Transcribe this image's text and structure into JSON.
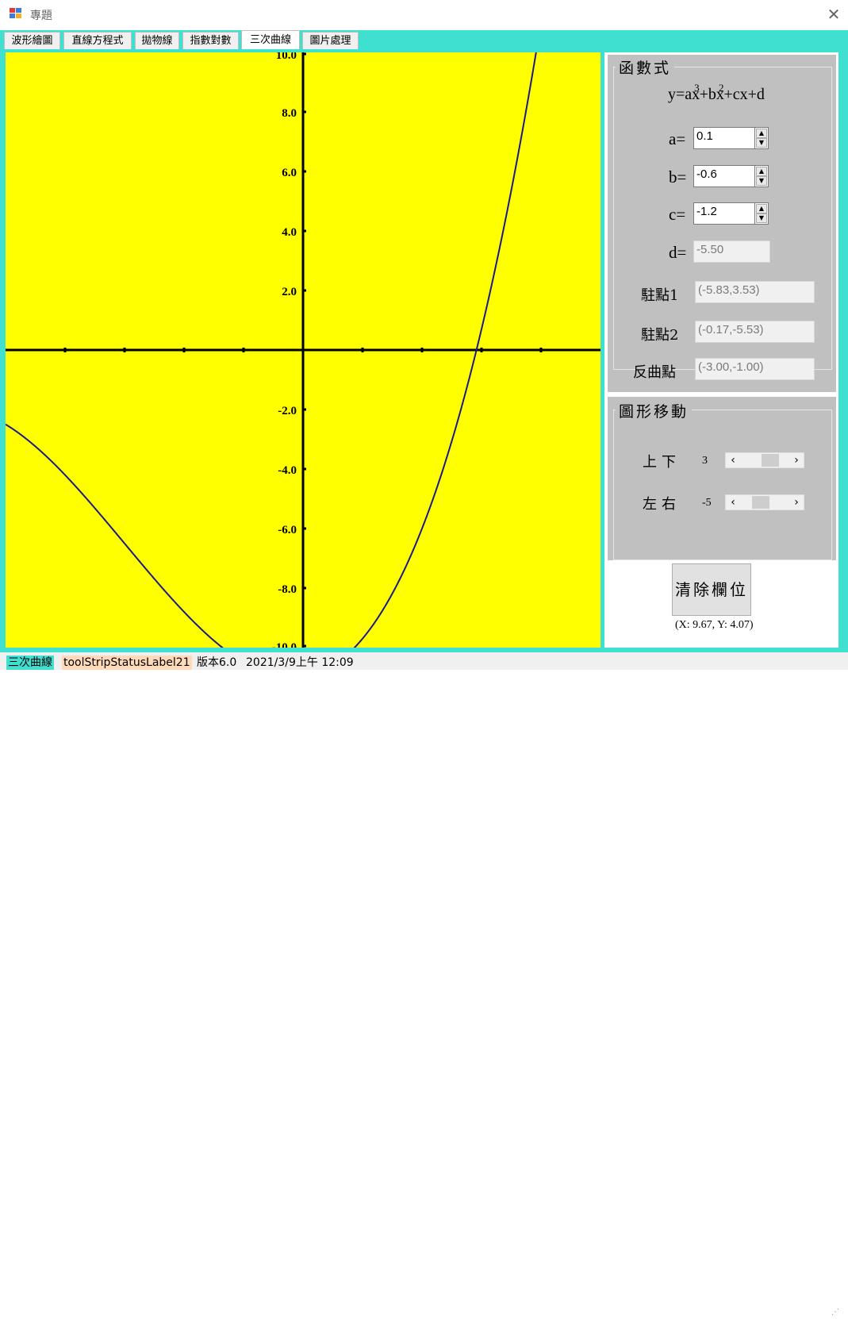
{
  "window": {
    "title": "專題",
    "close": "✕"
  },
  "tabs": [
    {
      "label": "波形繪圖",
      "active": false
    },
    {
      "label": "直線方程式",
      "active": false
    },
    {
      "label": "拋物線",
      "active": false
    },
    {
      "label": "指數對數",
      "active": false
    },
    {
      "label": "三次曲線",
      "active": true
    },
    {
      "label": "圖片處理",
      "active": false
    }
  ],
  "chart_data": {
    "type": "line",
    "x_range": [
      -5,
      5
    ],
    "y_range": [
      -10,
      10
    ],
    "y_ticks": [
      "10.0",
      "8.0",
      "6.0",
      "4.0",
      "2.0",
      "-2.0",
      "-4.0",
      "-6.0",
      "-8.0",
      "-10.0"
    ],
    "x_ticks": [
      -4,
      -3,
      -2,
      -1,
      1,
      2,
      3,
      4
    ],
    "curve": {
      "formula": "a(x-h)^3 + b(x-h)^2 + c(x-h) + d + k",
      "a": 0.1,
      "b": -0.6,
      "c": -1.2,
      "d": -5.5,
      "h": -5,
      "k": 3
    },
    "colors": {
      "background": "#ffff00",
      "axis": "#000000",
      "curve": "#1a1a8c"
    }
  },
  "formula_group": {
    "title": "函數式",
    "equation": {
      "pre": "y=ax",
      "exp1": "3",
      "mid": "+bx",
      "exp2": "2",
      "post": "+cx+d"
    },
    "a": {
      "label": "a=",
      "value": "0.1"
    },
    "b": {
      "label": "b=",
      "value": "-0.6"
    },
    "c": {
      "label": "c=",
      "value": "-1.2"
    },
    "d": {
      "label": "d=",
      "value": "-5.50"
    },
    "stationary1": {
      "label": "駐點1",
      "value": "(-5.83,3.53)"
    },
    "stationary2": {
      "label": "駐點2",
      "value": "(-0.17,-5.53)"
    },
    "inflection": {
      "label": "反曲點",
      "value": "(-3.00,-1.00)"
    }
  },
  "move_group": {
    "title": "圖形移動",
    "vertical": {
      "label": "上下",
      "value": "3",
      "position": 0.65
    },
    "horizontal": {
      "label": "左右",
      "value": "-5",
      "position": 0.35
    }
  },
  "clear_button": "清除欄位",
  "coordinate_readout": "(X: 9.67, Y: 4.07)",
  "statusbar": {
    "item1": "三次曲線",
    "item2": "toolStripStatusLabel21",
    "version": "版本6.0",
    "datetime": "2021/3/9上午 12:09"
  }
}
